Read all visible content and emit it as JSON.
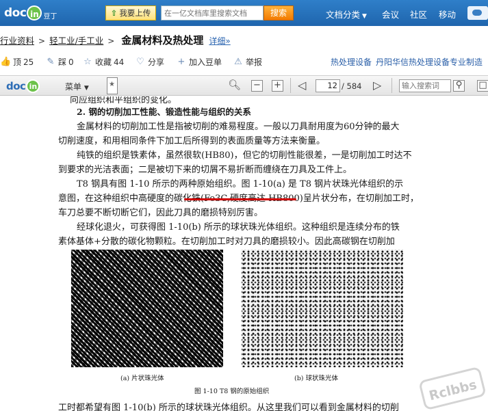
{
  "topbar": {
    "logo_text": "doc",
    "logo_badge": "in",
    "logo_tag": "豆丁",
    "upload_label": "我要上传",
    "search_placeholder": "在一亿文档库里搜索文档",
    "search_button": "搜索",
    "nav": [
      "文档分类",
      "会议",
      "社区",
      "移动"
    ]
  },
  "breadcrumb": {
    "items": [
      "行业资料",
      "轻工业/手工业"
    ],
    "title": "金属材料及热处理",
    "detail_link": "详细»"
  },
  "actions": {
    "top_label": "顶",
    "top_count": "25",
    "step_label": "踩",
    "step_count": "0",
    "favorite_label": "收藏",
    "favorite_count": "44",
    "share_label": "分享",
    "add_to_list_label": "加入豆单",
    "report_label": "举报",
    "ad_text_1": "热处理设备",
    "ad_text_2": "丹阳华信热处理设备专业制造"
  },
  "viewer": {
    "menu_label": "菜单",
    "current_page": "12",
    "total_pages": "/ 584",
    "search_placeholder": "输入搜索词"
  },
  "document": {
    "lines": [
      "向应组织和平组织的变化。",
      "2. 钢的切削加工性能、锻造性能与组织的关系",
      "金属材料的切削加工性是指被切削的难易程度。一般以刀具耐用度为60分钟的最大",
      "切削速度，和用相同条件下加工后所得到的表面质量等方法来衡量。",
      "纯铁的组织是铁素体，虽然很软(HB80)，但它的切削性能很差，一是切削加工时达不",
      "到要求的光洁表面；二是被切下来的切屑不易折断而缠绕在刀具及工件上。",
      "T8 钢具有图 1-10 所示的两种原始组织。图 1-10(a) 是 T8 钢片状珠光体组织的示",
      "意图，在这种组织中高硬度的碳化铁(Fe3C,硬度高达 HB800)呈片状分布，在切削加工时，",
      "车刀总要不断切断它们，因此刀具的磨损特别厉害。",
      "经球化退火，可获得图 1-10(b) 所示的球状珠光体组织。这种组织是连续分布的铁",
      "素体基体+分散的碳化物颗粒。在切削加工时对刀具的磨损较小。因此高碳钢在切削加",
      "工时都希望有图 1-10(b) 所示的球状珠光体组织。从这里我们可以看到金属材料的切削"
    ],
    "caption_a": "(a)  片状珠光体",
    "caption_b": "(b)  球状珠光体",
    "figure_caption": "图 1-10  T8 钢的原始组织"
  },
  "watermark": "Rclbbs"
}
